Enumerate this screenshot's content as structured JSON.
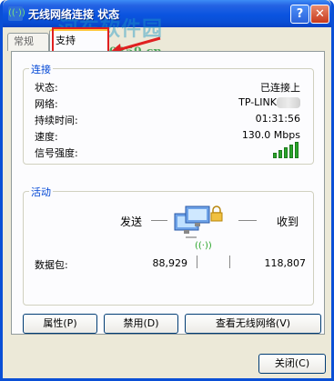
{
  "window": {
    "title": "无线网络连接 状态",
    "help_label": "?",
    "close_label": "✕"
  },
  "watermark": {
    "text": "河东软件园",
    "url": "www.pc0359.cn"
  },
  "tabs": [
    {
      "label": "常规"
    },
    {
      "label": "支持"
    }
  ],
  "connection": {
    "title": "连接",
    "rows": [
      {
        "label": "状态:",
        "value": "已连接上"
      },
      {
        "label": "网络:",
        "value": "TP-LINK"
      },
      {
        "label": "持续时间:",
        "value": "01:31:56"
      },
      {
        "label": "速度:",
        "value": "130.0 Mbps"
      },
      {
        "label": "信号强度:",
        "value": ""
      }
    ],
    "signal_level": 5,
    "signal_max": 5
  },
  "activity": {
    "title": "活动",
    "sent_label": "发送",
    "received_label": "收到",
    "packets_label": "数据包:",
    "packets_sent": "88,929",
    "packets_received": "118,807"
  },
  "buttons": {
    "properties": "属性(P)",
    "disable": "禁用(D)",
    "view_networks": "查看无线网络(V)",
    "close": "关闭(C)"
  },
  "colors": {
    "title_bar": "#0a4fd6",
    "group_title": "#0046d5",
    "signal": "#2aa52a",
    "highlight": "#e02020"
  }
}
